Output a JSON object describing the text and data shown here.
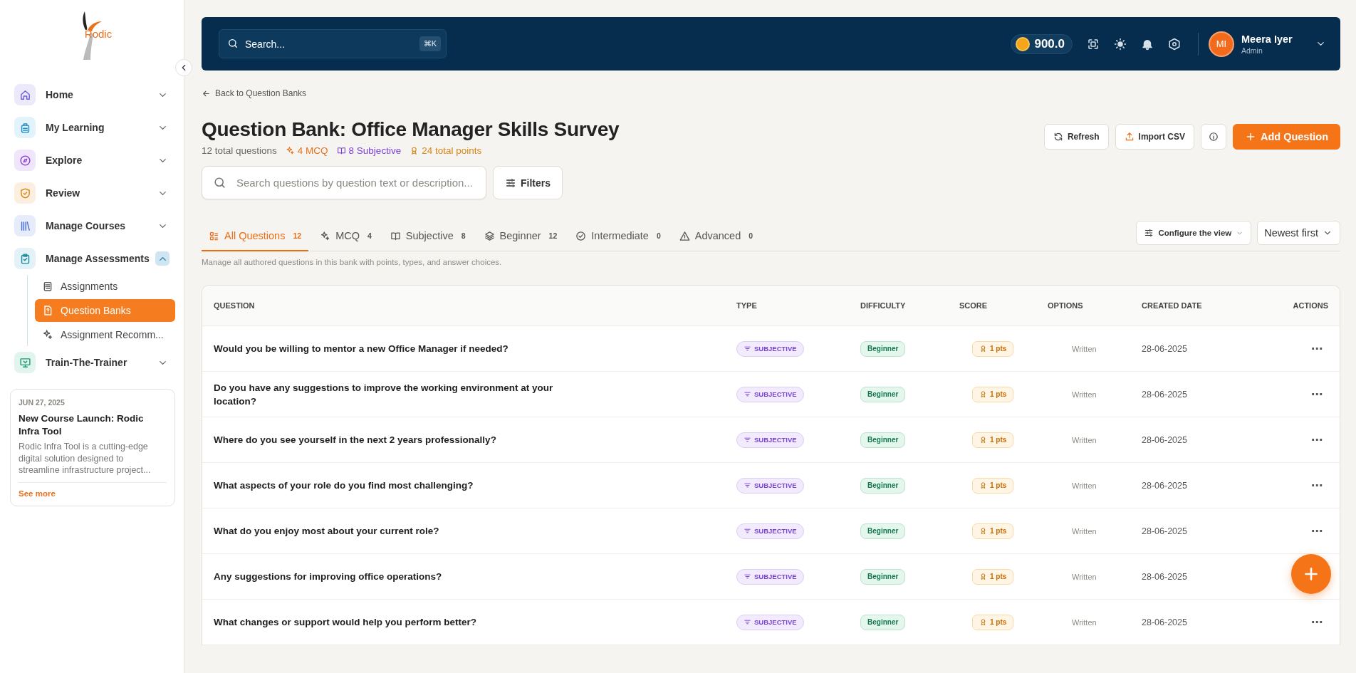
{
  "logo": {
    "text": "Rodic"
  },
  "sidebar": {
    "items": [
      {
        "label": "Home",
        "color": "#ece9fb",
        "selected": false,
        "expanded": false
      },
      {
        "label": "My Learning",
        "color": "#e3f3fb",
        "selected": false,
        "expanded": false
      },
      {
        "label": "Explore",
        "color": "#efe6fb",
        "selected": false,
        "expanded": false
      },
      {
        "label": "Review",
        "color": "#fcefe0",
        "selected": false,
        "expanded": false
      },
      {
        "label": "Manage Courses",
        "color": "#e6ecfb",
        "selected": false,
        "expanded": false
      },
      {
        "label": "Manage Assessments",
        "color": "#e3f2f6",
        "selected": false,
        "expanded": true,
        "children": [
          {
            "label": "Assignments",
            "selected": false
          },
          {
            "label": "Question Banks",
            "selected": true
          },
          {
            "label": "Assignment Recomm...",
            "selected": false
          }
        ]
      },
      {
        "label": "Train-The-Trainer",
        "color": "#e2f4ee",
        "selected": false,
        "expanded": false
      }
    ]
  },
  "news": {
    "date": "JUN 27, 2025",
    "title": "New Course Launch: Rodic Infra Tool",
    "body": "Rodic Infra Tool is a cutting-edge digital solution designed to streamline infrastructure project...",
    "link": "See more"
  },
  "topbar": {
    "search": {
      "placeholder": "Search...",
      "shortcut": "⌘K"
    },
    "coins": "900.0",
    "user": {
      "initials": "MI",
      "name": "Meera Iyer",
      "role": "Admin"
    }
  },
  "page": {
    "back": "Back to Question Banks",
    "title": "Question Bank: Office Manager Skills Survey",
    "stats": [
      {
        "kind": "total",
        "text": "12 total questions"
      },
      {
        "kind": "mcq",
        "text": "4 MCQ"
      },
      {
        "kind": "subjective",
        "text": "8 Subjective"
      },
      {
        "kind": "points",
        "text": "24 total points"
      }
    ],
    "actions": [
      {
        "kind": "refresh",
        "label": "Refresh"
      },
      {
        "kind": "import",
        "label": "Import CSV"
      },
      {
        "kind": "info"
      },
      {
        "kind": "add",
        "label": "Add Question"
      }
    ],
    "search": {
      "placeholder": "Search questions by question text or description..."
    },
    "filters": "Filters",
    "tabs": [
      {
        "label": "All Questions",
        "count": "12",
        "selected": true
      },
      {
        "label": "MCQ",
        "count": "4",
        "selected": false
      },
      {
        "label": "Subjective",
        "count": "8",
        "selected": false
      },
      {
        "label": "Beginner",
        "count": "12",
        "selected": false
      },
      {
        "label": "Intermediate",
        "count": "0",
        "selected": false
      },
      {
        "label": "Advanced",
        "count": "0",
        "selected": false
      }
    ],
    "configure": "Configure the view",
    "sort": "Newest first",
    "description": "Manage all authored questions in this bank with points, types, and answer choices."
  },
  "table": {
    "columns": [
      "QUESTION",
      "TYPE",
      "DIFFICULTY",
      "SCORE",
      "OPTIONS",
      "CREATED DATE",
      "ACTIONS"
    ],
    "rows": [
      {
        "question": "Would you be willing to mentor a new Office Manager if needed?",
        "type": "SUBJECTIVE",
        "difficulty": "Beginner",
        "score": "1 pts",
        "options": "Written",
        "created": "28-06-2025",
        "actions": "⋯"
      },
      {
        "question": "Do you have any suggestions to improve the working environment at your location?",
        "type": "SUBJECTIVE",
        "difficulty": "Beginner",
        "score": "1 pts",
        "options": "Written",
        "created": "28-06-2025",
        "actions": "⋯"
      },
      {
        "question": "Where do you see yourself in the next 2 years professionally?",
        "type": "SUBJECTIVE",
        "difficulty": "Beginner",
        "score": "1 pts",
        "options": "Written",
        "created": "28-06-2025",
        "actions": "⋯"
      },
      {
        "question": "What aspects of your role do you find most challenging?",
        "type": "SUBJECTIVE",
        "difficulty": "Beginner",
        "score": "1 pts",
        "options": "Written",
        "created": "28-06-2025",
        "actions": "⋯"
      },
      {
        "question": "What do you enjoy most about your current role?",
        "type": "SUBJECTIVE",
        "difficulty": "Beginner",
        "score": "1 pts",
        "options": "Written",
        "created": "28-06-2025",
        "actions": "⋯"
      },
      {
        "question": "Any suggestions for improving office operations?",
        "type": "SUBJECTIVE",
        "difficulty": "Beginner",
        "score": "1 pts",
        "options": "Written",
        "created": "28-06-2025"
      },
      {
        "question": "What changes or support would help you perform better?",
        "type": "SUBJECTIVE",
        "difficulty": "Beginner",
        "score": "1 pts",
        "options": "Written",
        "created": "28-06-2025",
        "actions": "⋯"
      }
    ]
  }
}
